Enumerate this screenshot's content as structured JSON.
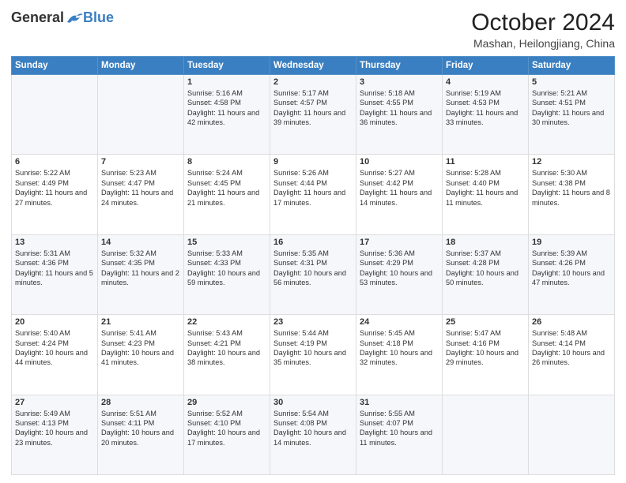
{
  "logo": {
    "general": "General",
    "blue": "Blue"
  },
  "header": {
    "month": "October 2024",
    "location": "Mashan, Heilongjiang, China"
  },
  "weekdays": [
    "Sunday",
    "Monday",
    "Tuesday",
    "Wednesday",
    "Thursday",
    "Friday",
    "Saturday"
  ],
  "weeks": [
    [
      {
        "day": "",
        "sunrise": "",
        "sunset": "",
        "daylight": ""
      },
      {
        "day": "",
        "sunrise": "",
        "sunset": "",
        "daylight": ""
      },
      {
        "day": "1",
        "sunrise": "Sunrise: 5:16 AM",
        "sunset": "Sunset: 4:58 PM",
        "daylight": "Daylight: 11 hours and 42 minutes."
      },
      {
        "day": "2",
        "sunrise": "Sunrise: 5:17 AM",
        "sunset": "Sunset: 4:57 PM",
        "daylight": "Daylight: 11 hours and 39 minutes."
      },
      {
        "day": "3",
        "sunrise": "Sunrise: 5:18 AM",
        "sunset": "Sunset: 4:55 PM",
        "daylight": "Daylight: 11 hours and 36 minutes."
      },
      {
        "day": "4",
        "sunrise": "Sunrise: 5:19 AM",
        "sunset": "Sunset: 4:53 PM",
        "daylight": "Daylight: 11 hours and 33 minutes."
      },
      {
        "day": "5",
        "sunrise": "Sunrise: 5:21 AM",
        "sunset": "Sunset: 4:51 PM",
        "daylight": "Daylight: 11 hours and 30 minutes."
      }
    ],
    [
      {
        "day": "6",
        "sunrise": "Sunrise: 5:22 AM",
        "sunset": "Sunset: 4:49 PM",
        "daylight": "Daylight: 11 hours and 27 minutes."
      },
      {
        "day": "7",
        "sunrise": "Sunrise: 5:23 AM",
        "sunset": "Sunset: 4:47 PM",
        "daylight": "Daylight: 11 hours and 24 minutes."
      },
      {
        "day": "8",
        "sunrise": "Sunrise: 5:24 AM",
        "sunset": "Sunset: 4:45 PM",
        "daylight": "Daylight: 11 hours and 21 minutes."
      },
      {
        "day": "9",
        "sunrise": "Sunrise: 5:26 AM",
        "sunset": "Sunset: 4:44 PM",
        "daylight": "Daylight: 11 hours and 17 minutes."
      },
      {
        "day": "10",
        "sunrise": "Sunrise: 5:27 AM",
        "sunset": "Sunset: 4:42 PM",
        "daylight": "Daylight: 11 hours and 14 minutes."
      },
      {
        "day": "11",
        "sunrise": "Sunrise: 5:28 AM",
        "sunset": "Sunset: 4:40 PM",
        "daylight": "Daylight: 11 hours and 11 minutes."
      },
      {
        "day": "12",
        "sunrise": "Sunrise: 5:30 AM",
        "sunset": "Sunset: 4:38 PM",
        "daylight": "Daylight: 11 hours and 8 minutes."
      }
    ],
    [
      {
        "day": "13",
        "sunrise": "Sunrise: 5:31 AM",
        "sunset": "Sunset: 4:36 PM",
        "daylight": "Daylight: 11 hours and 5 minutes."
      },
      {
        "day": "14",
        "sunrise": "Sunrise: 5:32 AM",
        "sunset": "Sunset: 4:35 PM",
        "daylight": "Daylight: 11 hours and 2 minutes."
      },
      {
        "day": "15",
        "sunrise": "Sunrise: 5:33 AM",
        "sunset": "Sunset: 4:33 PM",
        "daylight": "Daylight: 10 hours and 59 minutes."
      },
      {
        "day": "16",
        "sunrise": "Sunrise: 5:35 AM",
        "sunset": "Sunset: 4:31 PM",
        "daylight": "Daylight: 10 hours and 56 minutes."
      },
      {
        "day": "17",
        "sunrise": "Sunrise: 5:36 AM",
        "sunset": "Sunset: 4:29 PM",
        "daylight": "Daylight: 10 hours and 53 minutes."
      },
      {
        "day": "18",
        "sunrise": "Sunrise: 5:37 AM",
        "sunset": "Sunset: 4:28 PM",
        "daylight": "Daylight: 10 hours and 50 minutes."
      },
      {
        "day": "19",
        "sunrise": "Sunrise: 5:39 AM",
        "sunset": "Sunset: 4:26 PM",
        "daylight": "Daylight: 10 hours and 47 minutes."
      }
    ],
    [
      {
        "day": "20",
        "sunrise": "Sunrise: 5:40 AM",
        "sunset": "Sunset: 4:24 PM",
        "daylight": "Daylight: 10 hours and 44 minutes."
      },
      {
        "day": "21",
        "sunrise": "Sunrise: 5:41 AM",
        "sunset": "Sunset: 4:23 PM",
        "daylight": "Daylight: 10 hours and 41 minutes."
      },
      {
        "day": "22",
        "sunrise": "Sunrise: 5:43 AM",
        "sunset": "Sunset: 4:21 PM",
        "daylight": "Daylight: 10 hours and 38 minutes."
      },
      {
        "day": "23",
        "sunrise": "Sunrise: 5:44 AM",
        "sunset": "Sunset: 4:19 PM",
        "daylight": "Daylight: 10 hours and 35 minutes."
      },
      {
        "day": "24",
        "sunrise": "Sunrise: 5:45 AM",
        "sunset": "Sunset: 4:18 PM",
        "daylight": "Daylight: 10 hours and 32 minutes."
      },
      {
        "day": "25",
        "sunrise": "Sunrise: 5:47 AM",
        "sunset": "Sunset: 4:16 PM",
        "daylight": "Daylight: 10 hours and 29 minutes."
      },
      {
        "day": "26",
        "sunrise": "Sunrise: 5:48 AM",
        "sunset": "Sunset: 4:14 PM",
        "daylight": "Daylight: 10 hours and 26 minutes."
      }
    ],
    [
      {
        "day": "27",
        "sunrise": "Sunrise: 5:49 AM",
        "sunset": "Sunset: 4:13 PM",
        "daylight": "Daylight: 10 hours and 23 minutes."
      },
      {
        "day": "28",
        "sunrise": "Sunrise: 5:51 AM",
        "sunset": "Sunset: 4:11 PM",
        "daylight": "Daylight: 10 hours and 20 minutes."
      },
      {
        "day": "29",
        "sunrise": "Sunrise: 5:52 AM",
        "sunset": "Sunset: 4:10 PM",
        "daylight": "Daylight: 10 hours and 17 minutes."
      },
      {
        "day": "30",
        "sunrise": "Sunrise: 5:54 AM",
        "sunset": "Sunset: 4:08 PM",
        "daylight": "Daylight: 10 hours and 14 minutes."
      },
      {
        "day": "31",
        "sunrise": "Sunrise: 5:55 AM",
        "sunset": "Sunset: 4:07 PM",
        "daylight": "Daylight: 10 hours and 11 minutes."
      },
      {
        "day": "",
        "sunrise": "",
        "sunset": "",
        "daylight": ""
      },
      {
        "day": "",
        "sunrise": "",
        "sunset": "",
        "daylight": ""
      }
    ]
  ]
}
